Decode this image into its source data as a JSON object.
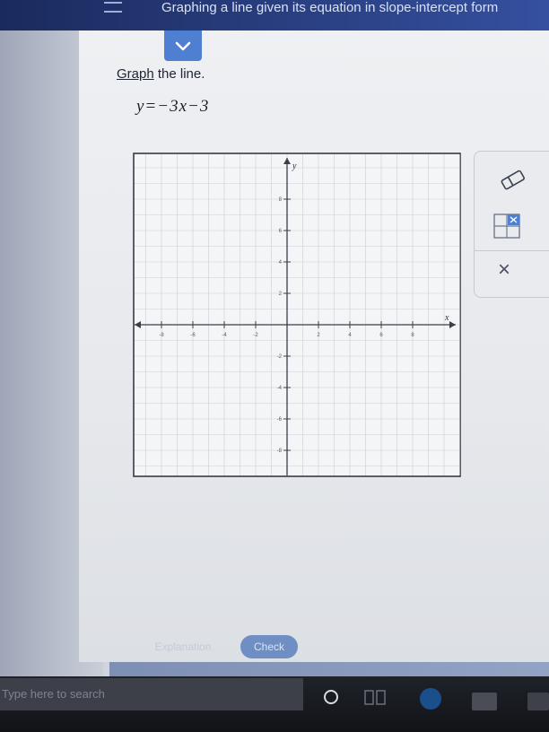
{
  "header": {
    "title": "Graphing a line given its equation in slope-intercept form"
  },
  "problem": {
    "instruction_verb": "Graph",
    "instruction_rest": " the line.",
    "equation": "y=−3x−3"
  },
  "graph": {
    "x_axis_label": "x",
    "y_axis_label": "y",
    "x_range": [
      -5,
      5
    ],
    "y_range": [
      -5,
      10
    ],
    "x_tick_labels": [
      {
        "value": -8,
        "label": "-8"
      },
      {
        "value": -6,
        "label": "-6"
      },
      {
        "value": -4,
        "label": "-4"
      },
      {
        "value": -2,
        "label": "-2"
      },
      {
        "value": 2,
        "label": "2"
      },
      {
        "value": 4,
        "label": "4"
      },
      {
        "value": 6,
        "label": "6"
      },
      {
        "value": 8,
        "label": "8"
      }
    ],
    "y_tick_labels": [
      {
        "value": 8,
        "label": "8"
      },
      {
        "value": 6,
        "label": "6"
      },
      {
        "value": 4,
        "label": "4"
      },
      {
        "value": 2,
        "label": "2"
      },
      {
        "value": -2,
        "label": "-2"
      },
      {
        "value": -4,
        "label": "-4"
      },
      {
        "value": -6,
        "label": "-6"
      },
      {
        "value": -8,
        "label": "-8"
      }
    ]
  },
  "tools": {
    "eraser": "eraser-icon",
    "undo_grid": "grid-undo-icon",
    "close_symbol": "×"
  },
  "actions": {
    "explanation_label": "Explanation",
    "check_label": "Check"
  },
  "taskbar": {
    "search_placeholder": "Type here to search"
  },
  "colors": {
    "header": "#263a78",
    "accent": "#4f7fd0",
    "check_button": "#6f8fc4"
  }
}
